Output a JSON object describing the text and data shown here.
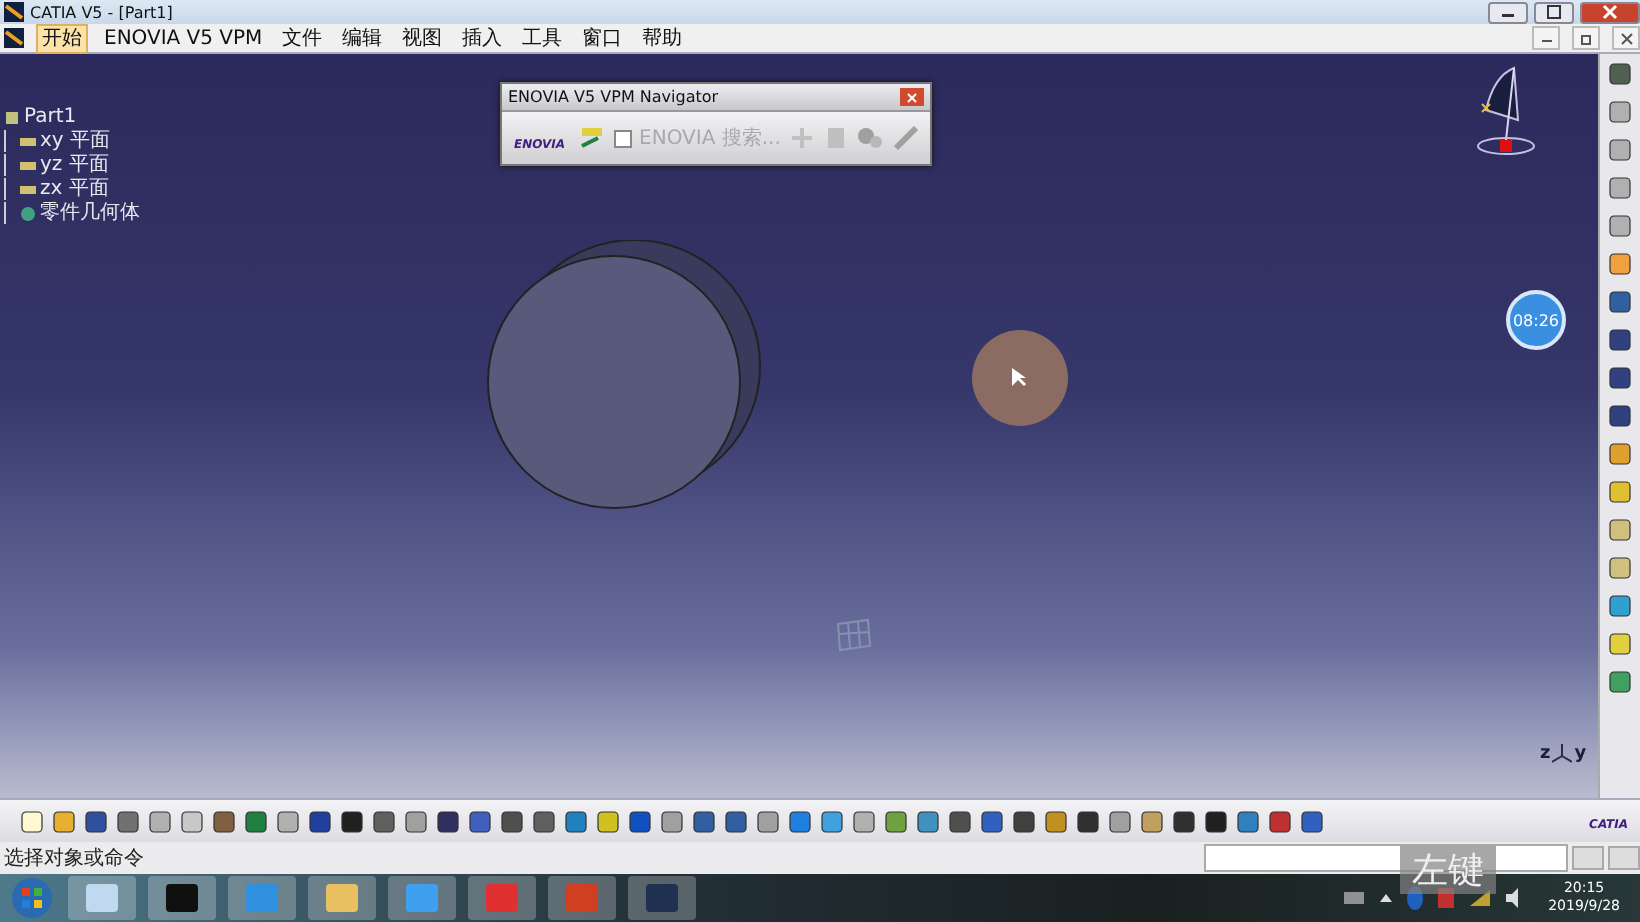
{
  "window": {
    "title": "CATIA V5 - [Part1]"
  },
  "menu": [
    {
      "label": "开始",
      "selected": true
    },
    {
      "label": "ENOVIA V5 VPM",
      "selected": false
    },
    {
      "label": "文件",
      "selected": false
    },
    {
      "label": "编辑",
      "selected": false
    },
    {
      "label": "视图",
      "selected": false
    },
    {
      "label": "插入",
      "selected": false
    },
    {
      "label": "工具",
      "selected": false
    },
    {
      "label": "窗口",
      "selected": false
    },
    {
      "label": "帮助",
      "selected": false
    }
  ],
  "tree": {
    "label": "Part1",
    "children": [
      {
        "label": "xy 平面"
      },
      {
        "label": "yz 平面"
      },
      {
        "label": "zx 平面"
      },
      {
        "label": "零件几何体"
      }
    ]
  },
  "navigator": {
    "title": "ENOVIA V5 VPM Navigator",
    "logo": "ENOVIA",
    "search_label": "ENOVIA 搜索...",
    "search_checked": false
  },
  "timer_badge": "08:26",
  "axis_labels": [
    "z",
    "y"
  ],
  "toolbar_logo": "CATIA",
  "key_overlay": "左键",
  "status_bar": {
    "prompt": "选择对象或命令"
  },
  "taskbar": {
    "time": "20:15",
    "date": "2019/9/28"
  }
}
